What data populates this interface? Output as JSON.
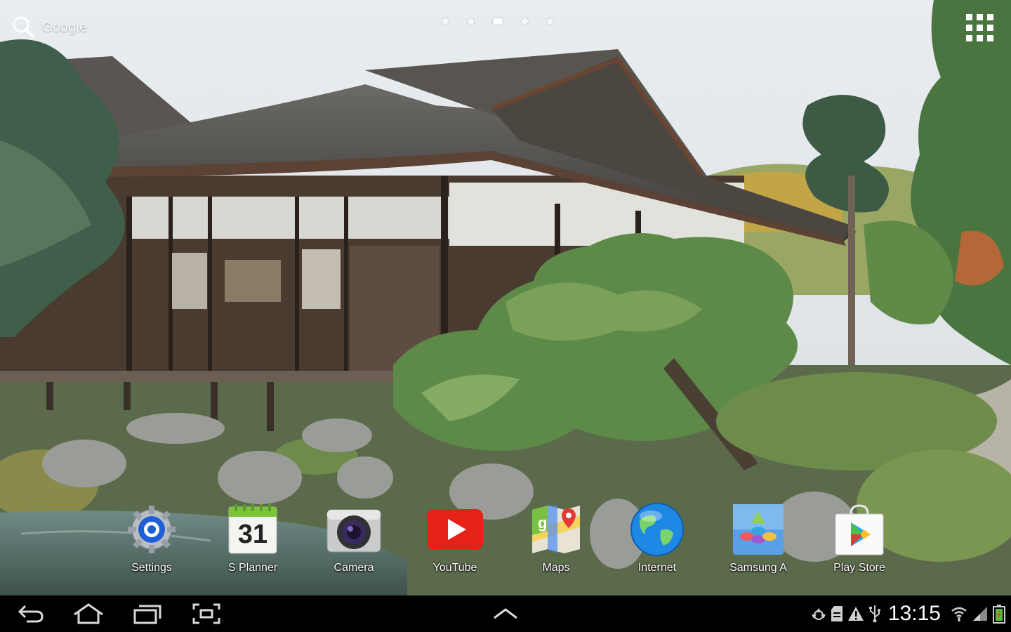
{
  "search": {
    "label": "Google"
  },
  "pages": {
    "count": 5,
    "current": 3
  },
  "dock": {
    "apps": [
      {
        "name": "Settings",
        "icon": "settings-icon"
      },
      {
        "name": "S Planner",
        "icon": "calendar-icon",
        "date": "31"
      },
      {
        "name": "Camera",
        "icon": "camera-icon"
      },
      {
        "name": "YouTube",
        "icon": "youtube-icon"
      },
      {
        "name": "Maps",
        "icon": "maps-icon"
      },
      {
        "name": "Internet",
        "icon": "globe-icon"
      },
      {
        "name": "Samsung A",
        "icon": "samsung-apps-icon"
      },
      {
        "name": "Play Store",
        "icon": "play-store-icon"
      }
    ]
  },
  "navigation": {
    "buttons": [
      "back-icon",
      "home-icon",
      "recent-apps-icon",
      "screenshot-icon"
    ],
    "center": "chevron-up-icon"
  },
  "status": {
    "time": "13:15",
    "icons": [
      "recycle-icon",
      "sd-card-icon",
      "warning-icon",
      "usb-icon",
      "wifi-icon",
      "signal-icon",
      "battery-icon"
    ]
  },
  "colors": {
    "navbar": "#000000",
    "battery": "#e53935",
    "youtube": "#e62117"
  }
}
